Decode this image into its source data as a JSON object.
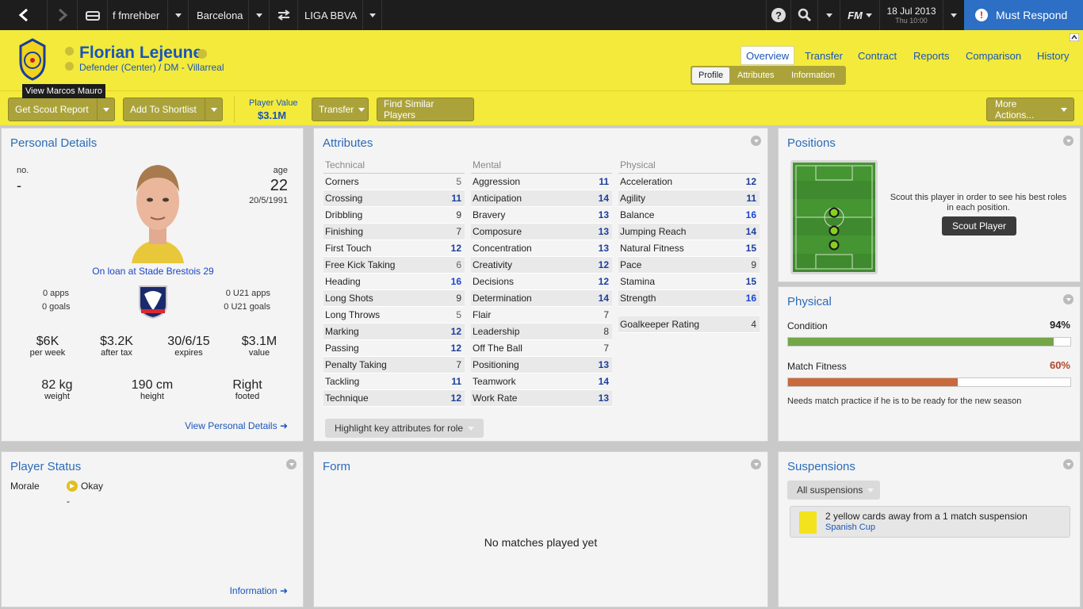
{
  "topbar": {
    "profile": "f fmrehber",
    "club": "Barcelona",
    "competition": "LIGA BBVA",
    "fm_label": "FM",
    "date": "18 Jul 2013",
    "time": "Thu 10:00",
    "must_respond": "Must Respond"
  },
  "header": {
    "player_name": "Florian Lejeune",
    "subtitle": "Defender (Center) / DM - Villarreal",
    "tooltip": "View Marcos Mauro",
    "nav": [
      "Overview",
      "Transfer",
      "Contract",
      "Reports",
      "Comparison",
      "History"
    ],
    "subtabs": [
      "Profile",
      "Attributes",
      "Information"
    ]
  },
  "toolbar": {
    "scout_report": "Get Scout Report",
    "add_shortlist": "Add To Shortlist",
    "player_value_label": "Player Value",
    "player_value": "$3.1M",
    "transfer": "Transfer",
    "find_similar": "Find Similar Players",
    "more_actions": "More Actions..."
  },
  "personal": {
    "title": "Personal Details",
    "no_label": "no.",
    "no_value": "-",
    "age_label": "age",
    "age": "22",
    "dob": "20/5/1991",
    "loan": "On loan at Stade Brestois 29",
    "apps": "0 apps",
    "goals": "0 goals",
    "u21_apps": "0 U21 apps",
    "u21_goals": "0 U21 goals",
    "wage": "$6K",
    "wage_label": "per week",
    "after_tax": "$3.2K",
    "after_tax_label": "after tax",
    "expires": "30/6/15",
    "expires_label": "expires",
    "value": "$3.1M",
    "value_label": "value",
    "weight": "82 kg",
    "weight_label": "weight",
    "height": "190 cm",
    "height_label": "height",
    "foot": "Right",
    "foot_label": "footed",
    "link": "View Personal Details"
  },
  "attributes": {
    "title": "Attributes",
    "technical_label": "Technical",
    "mental_label": "Mental",
    "physical_label": "Physical",
    "technical": [
      [
        "Corners",
        "5"
      ],
      [
        "Crossing",
        "11"
      ],
      [
        "Dribbling",
        "9"
      ],
      [
        "Finishing",
        "7"
      ],
      [
        "First Touch",
        "12"
      ],
      [
        "Free Kick Taking",
        "6"
      ],
      [
        "Heading",
        "16"
      ],
      [
        "Long Shots",
        "9"
      ],
      [
        "Long Throws",
        "5"
      ],
      [
        "Marking",
        "12"
      ],
      [
        "Passing",
        "12"
      ],
      [
        "Penalty Taking",
        "7"
      ],
      [
        "Tackling",
        "11"
      ],
      [
        "Technique",
        "12"
      ]
    ],
    "mental": [
      [
        "Aggression",
        "11"
      ],
      [
        "Anticipation",
        "14"
      ],
      [
        "Bravery",
        "13"
      ],
      [
        "Composure",
        "13"
      ],
      [
        "Concentration",
        "13"
      ],
      [
        "Creativity",
        "12"
      ],
      [
        "Decisions",
        "12"
      ],
      [
        "Determination",
        "14"
      ],
      [
        "Flair",
        "7"
      ],
      [
        "Leadership",
        "8"
      ],
      [
        "Off The Ball",
        "7"
      ],
      [
        "Positioning",
        "13"
      ],
      [
        "Teamwork",
        "14"
      ],
      [
        "Work Rate",
        "13"
      ]
    ],
    "physical": [
      [
        "Acceleration",
        "12"
      ],
      [
        "Agility",
        "11"
      ],
      [
        "Balance",
        "16"
      ],
      [
        "Jumping Reach",
        "14"
      ],
      [
        "Natural Fitness",
        "15"
      ],
      [
        "Pace",
        "9"
      ],
      [
        "Stamina",
        "15"
      ],
      [
        "Strength",
        "16"
      ]
    ],
    "gk_label": "Goalkeeper Rating",
    "gk_value": "4",
    "highlight_btn": "Highlight key attributes for role"
  },
  "positions": {
    "title": "Positions",
    "scout_text": "Scout this player in order to see his best roles in each position.",
    "scout_btn": "Scout Player"
  },
  "physical": {
    "title": "Physical",
    "condition_label": "Condition",
    "condition": "94%",
    "condition_fraction": 0.94,
    "fitness_label": "Match Fitness",
    "fitness": "60%",
    "fitness_fraction": 0.6,
    "note": "Needs match practice if he is to be ready for the new season"
  },
  "status": {
    "title": "Player Status",
    "morale_label": "Morale",
    "morale": "Okay",
    "dash": "-",
    "link": "Information"
  },
  "form": {
    "title": "Form",
    "empty": "No matches played yet"
  },
  "suspensions": {
    "title": "Suspensions",
    "filter": "All suspensions",
    "text": "2 yellow cards away from a 1 match suspension",
    "competition": "Spanish Cup"
  }
}
